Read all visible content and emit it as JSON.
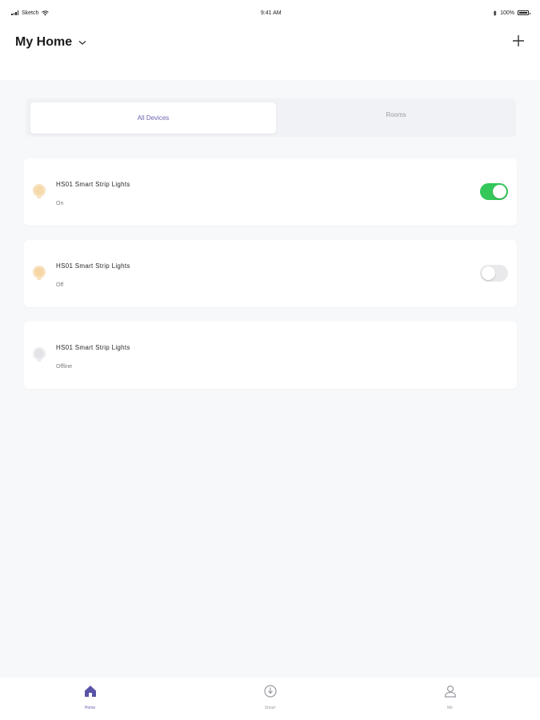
{
  "status_bar": {
    "carrier": "Sketch",
    "time": "9:41 AM",
    "battery": "100%"
  },
  "header": {
    "title": "My Home",
    "add_icon": "plus-icon",
    "dropdown_icon": "chevron-down-icon"
  },
  "tabs": {
    "all_devices": "All Devices",
    "rooms": "Rooms"
  },
  "devices": [
    {
      "name": "HS01 Smart Strip Lights",
      "status": "On",
      "toggle": "on",
      "icon": "bulb-icon"
    },
    {
      "name": "HS01 Smart Strip Lights",
      "status": "Off",
      "toggle": "off",
      "icon": "bulb-icon"
    },
    {
      "name": "HS01 Smart Strip Lights",
      "status": "Offline",
      "icon": "bulb-icon"
    }
  ],
  "tabbar": {
    "home": "Home",
    "smart": "Smart",
    "me": "Me"
  },
  "colors": {
    "accent": "#6a64b0",
    "toggle_on": "#34c759",
    "bulb_on": "#f3c98b",
    "bulb_offline": "#d9d9de",
    "background": "#f7f8fa"
  }
}
